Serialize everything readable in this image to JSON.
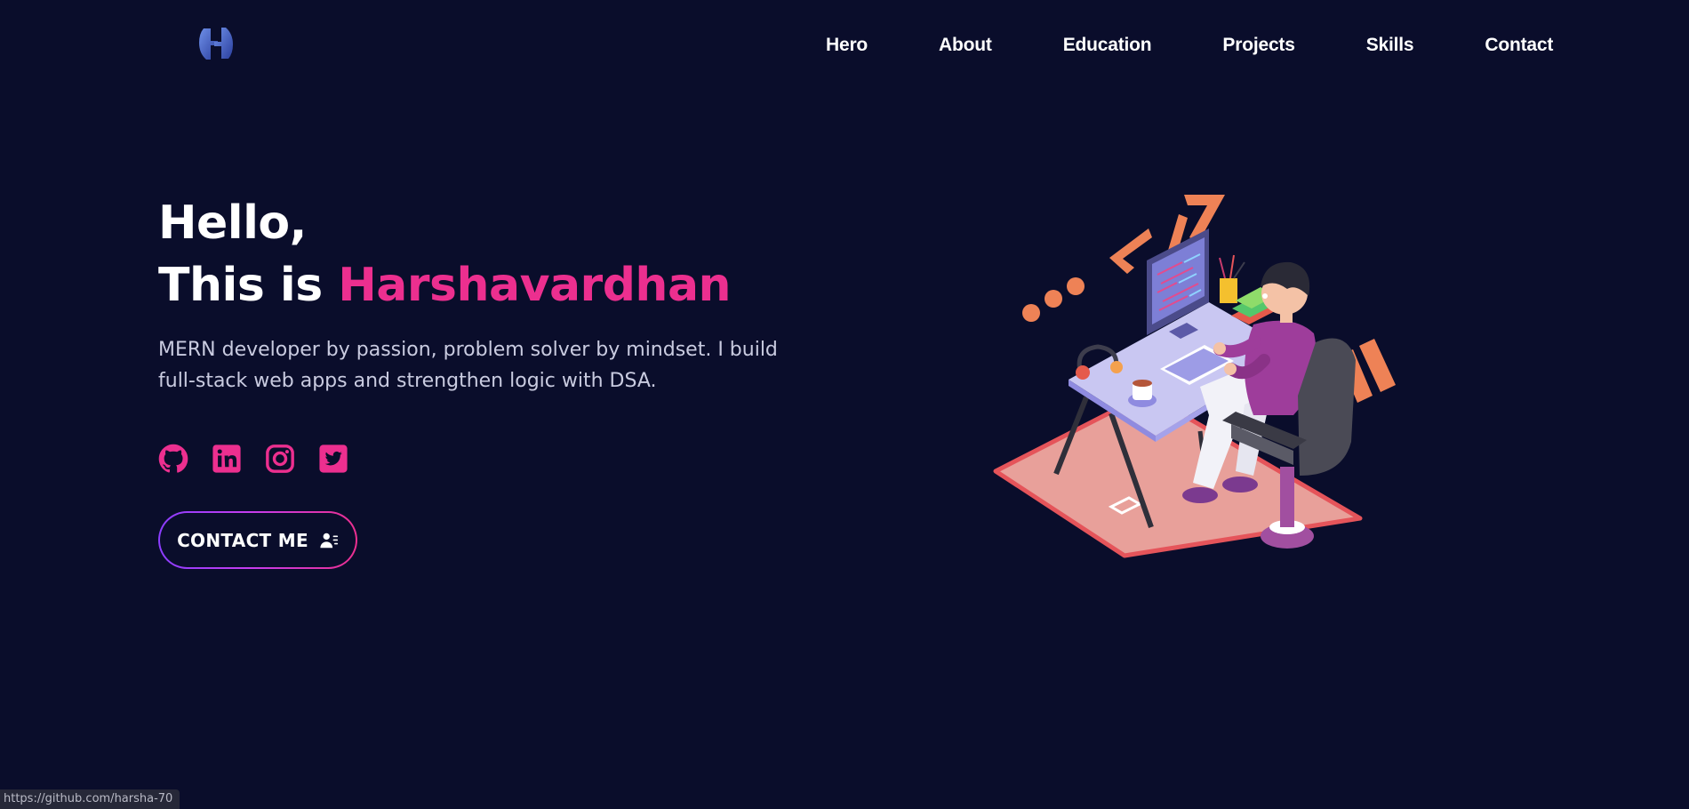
{
  "nav": {
    "items": [
      {
        "label": "Hero"
      },
      {
        "label": "About"
      },
      {
        "label": "Education"
      },
      {
        "label": "Projects"
      },
      {
        "label": "Skills"
      },
      {
        "label": "Contact"
      }
    ]
  },
  "hero": {
    "greeting": "Hello,",
    "intro_prefix": "This is ",
    "name": "Harshavardhan",
    "tagline": "MERN developer by passion, problem solver by mindset. I build full-stack web apps and strengthen logic with DSA.",
    "contact_label": "CONTACT ME"
  },
  "socials": [
    {
      "icon": "github-icon"
    },
    {
      "icon": "linkedin-icon"
    },
    {
      "icon": "instagram-icon"
    },
    {
      "icon": "twitter-icon"
    }
  ],
  "status_bar": {
    "url": "https://github.com/harsha-70"
  },
  "colors": {
    "background": "#0a0d2b",
    "accent": "#ec2f8f",
    "button_gradient_start": "#8b3dff",
    "button_gradient_end": "#ec2f8f"
  }
}
